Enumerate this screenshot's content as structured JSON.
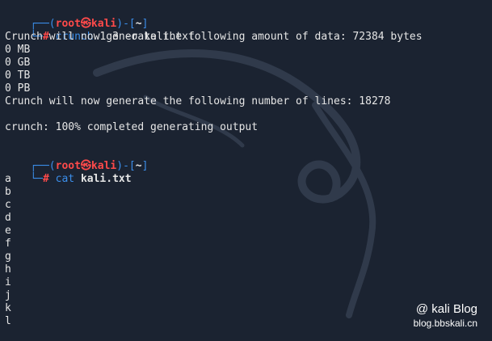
{
  "prompt": {
    "corner_top": "┌──(",
    "user_host": "root㉿kali",
    "sep": ")-[",
    "dir": "~",
    "close": "]",
    "corner_bottom": "└─",
    "symbol": "#"
  },
  "cmd1": {
    "program": "crunch",
    "args": "1 3 -o kali.txt"
  },
  "output1": [
    "Crunch will now generate the following amount of data: 72384 bytes",
    "0 MB",
    "0 GB",
    "0 TB",
    "0 PB",
    "Crunch will now generate the following number of lines: 18278"
  ],
  "output2": "crunch: 100% completed generating output",
  "cmd2": {
    "program": "cat",
    "args": "kali.txt"
  },
  "cat_output": [
    "a",
    "b",
    "c",
    "d",
    "e",
    "f",
    "g",
    "h",
    "i",
    "j",
    "k",
    "l"
  ],
  "watermark": {
    "title": "@ kali Blog",
    "url": "blog.bbskali.cn"
  },
  "colors": {
    "background": "#1b2331",
    "prompt_box": "#3b8eea",
    "user": "#ff4a4a"
  }
}
